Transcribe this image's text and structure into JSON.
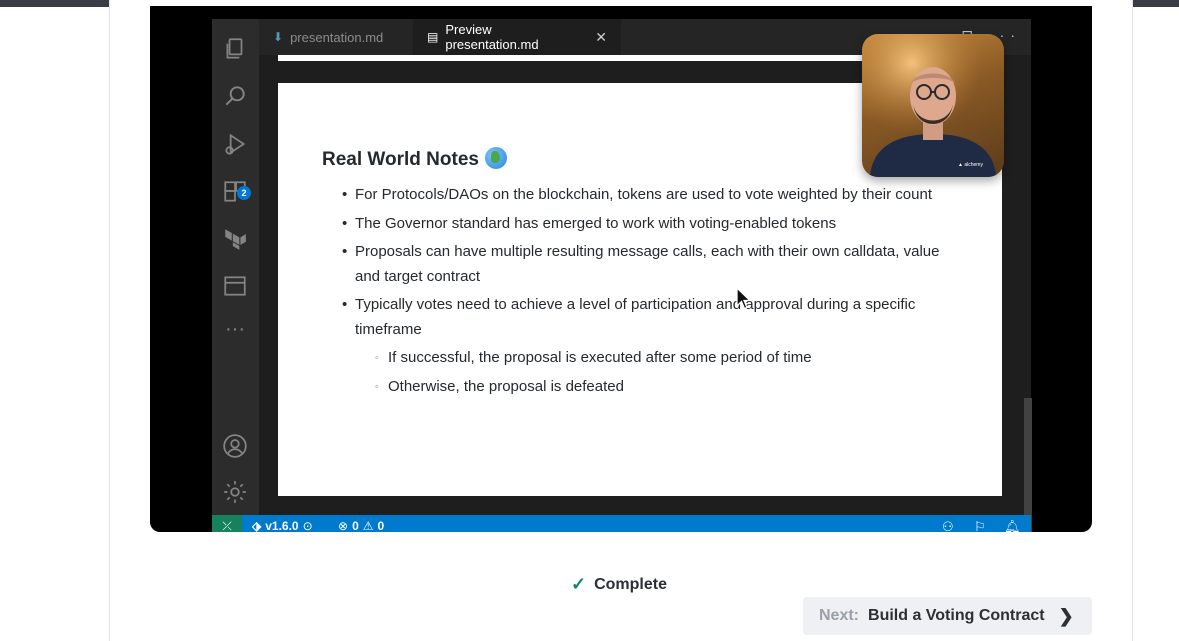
{
  "video": {
    "tabs": [
      {
        "label": "presentation.md",
        "active": false
      },
      {
        "label": "Preview presentation.md",
        "active": true
      }
    ],
    "activity_badge": "2",
    "slide": {
      "title": "Real World Notes",
      "title_emoji": "globe-icon",
      "bullets": [
        "For Protocols/DAOs on the blockchain, tokens are used to vote weighted by their count",
        "The Governor standard has emerged to work with voting-enabled tokens",
        "Proposals can have multiple resulting message calls, each with their own calldata, value and target contract",
        "Typically votes need to achieve a level of participation and approval during a specific timeframe"
      ],
      "sub_bullets": [
        "If successful, the proposal is executed after some period of time",
        "Otherwise, the proposal is defeated"
      ]
    },
    "status": {
      "version": "v1.6.0",
      "errors": "0",
      "warnings": "0"
    }
  },
  "lesson": {
    "complete_label": "Complete",
    "next_prefix": "Next:",
    "next_title": "Build a Voting Contract"
  },
  "colors": {
    "vscode_blue": "#007acc",
    "complete_check": "#0f8a6f",
    "next_button_bg": "#eef0f3"
  }
}
